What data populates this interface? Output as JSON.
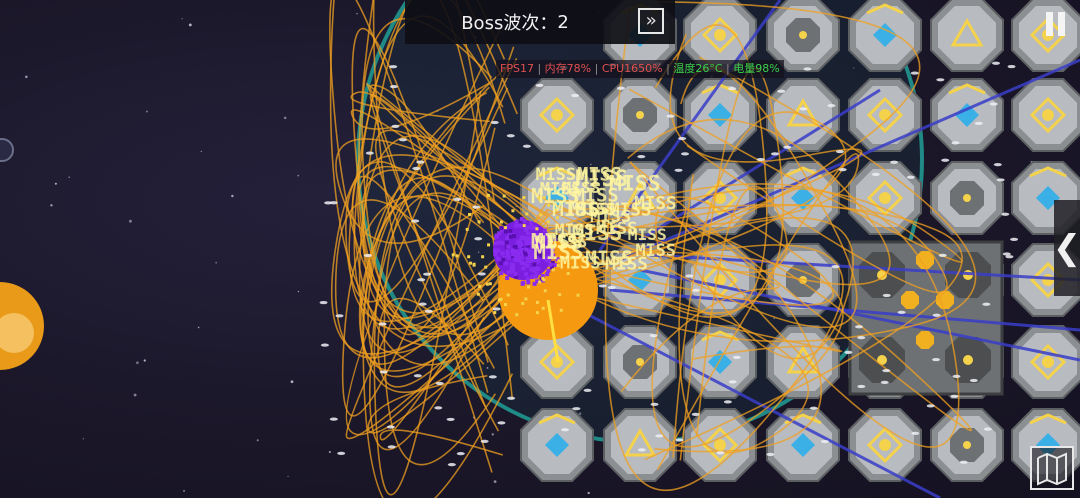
{
  "hud": {
    "wave_label": "Boss波次：",
    "wave_value": "2",
    "fast_forward_icon": "double-chevron-right-icon",
    "pause_icon": "pause-icon",
    "side_panel_icon": "chevron-left-icon",
    "map_icon": "folded-map-icon"
  },
  "stats": {
    "fps": "FPS17",
    "memory": "内存78%",
    "cpu": "CPU1650%",
    "temperature": "温度26°C",
    "battery": "电量98%",
    "separator": "|"
  },
  "battle": {
    "floating_text": "MISS"
  },
  "colors": {
    "background": "#1b1729",
    "module_gray": "#b8bbbf",
    "module_dark": "#6e7173",
    "accent_yellow": "#f4d24b",
    "accent_blue": "#3ab0e6",
    "tentacle_orange": "#f0a020",
    "boss_purple": "#7a1ee0",
    "boss_orange": "#f59a10",
    "laser_blue": "#3a3ec8",
    "shield_teal": "#1f8a86",
    "fps_red": "#e05050",
    "stat_green": "#3ccf4a"
  }
}
